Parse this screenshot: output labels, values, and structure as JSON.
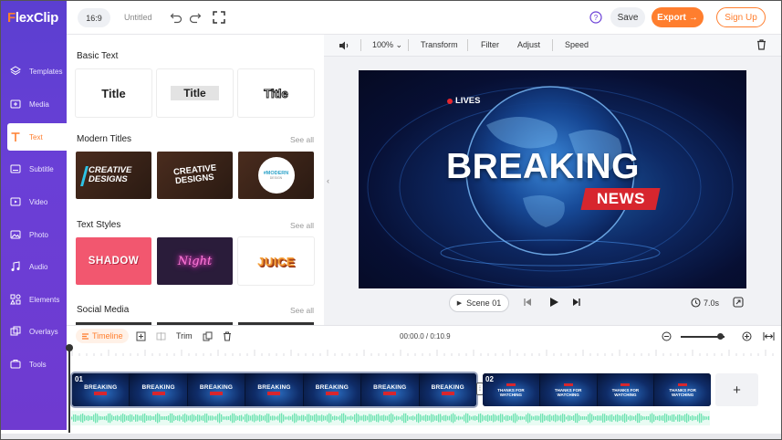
{
  "app": {
    "logo_letter": "F",
    "logo_rest": "lexClip"
  },
  "sidebar": {
    "items": [
      {
        "label": "Templates",
        "icon": "layers-icon"
      },
      {
        "label": "Media",
        "icon": "media-icon"
      },
      {
        "label": "Text",
        "icon": "text-icon",
        "active": true
      },
      {
        "label": "Subtitle",
        "icon": "subtitle-icon"
      },
      {
        "label": "Video",
        "icon": "video-icon"
      },
      {
        "label": "Photo",
        "icon": "photo-icon"
      },
      {
        "label": "Audio",
        "icon": "audio-icon"
      },
      {
        "label": "Elements",
        "icon": "elements-icon"
      },
      {
        "label": "Overlays",
        "icon": "overlays-icon"
      },
      {
        "label": "Tools",
        "icon": "tools-icon"
      }
    ]
  },
  "topbar": {
    "ratio": "16:9",
    "project_name": "Untitled",
    "save_label": "Save",
    "export_label": "Export",
    "export_arrow": "→",
    "signup_label": "Sign Up"
  },
  "panel": {
    "basic_text": {
      "title": "Basic Text",
      "cards": [
        "Title",
        "Title",
        "Title"
      ]
    },
    "modern_titles": {
      "title": "Modern Titles",
      "see_all": "See all",
      "cards": [
        {
          "line1": "CREATIVE",
          "line2": "DESIGNS"
        },
        {
          "line1": "CREATIVE",
          "line2": "DESIGNS"
        },
        {
          "line1": "#MODERN",
          "line2": "DESIGN"
        }
      ]
    },
    "text_styles": {
      "title": "Text Styles",
      "see_all": "See all",
      "cards": [
        "SHADOW",
        "Night",
        "JUICE"
      ]
    },
    "social_media": {
      "title": "Social Media",
      "see_all": "See all"
    }
  },
  "canvas_toolbar": {
    "zoom": "100%",
    "items": [
      "Transform",
      "Filter",
      "Adjust",
      "Speed"
    ]
  },
  "video": {
    "live_label": "LIVES",
    "headline": "BREAKING",
    "tag": "NEWS"
  },
  "player": {
    "scene_label": "Scene 01",
    "duration": "7.0s"
  },
  "timeline": {
    "tab_label": "Timeline",
    "trim_label": "Trim",
    "time_readout": "00:00.0 / 0:10.9",
    "zoom_level": 0.9,
    "clip1": {
      "number": "01",
      "thumb_text": "BREAKING"
    },
    "clip2": {
      "number": "02",
      "thumb_text1": "THANKS FOR",
      "thumb_text2": "WATCHING"
    },
    "add_label": "+"
  },
  "colors": {
    "brand_orange": "#ff7e2e",
    "sidebar_purple": "#5b3fd0",
    "news_red": "#d7262e",
    "audio_wave": "#6fe3b2"
  }
}
